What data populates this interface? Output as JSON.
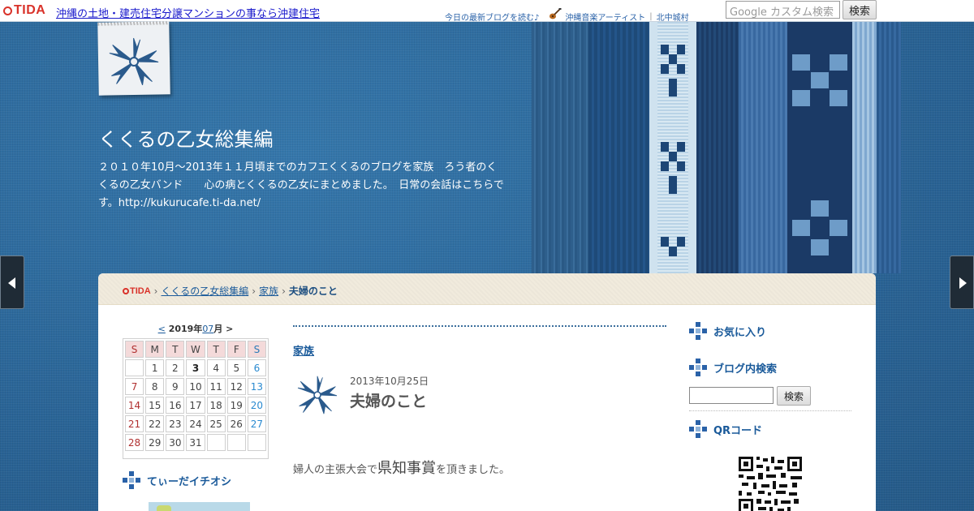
{
  "topbar": {
    "logo": "TIDA",
    "main_link": "沖縄の土地・建売住宅分譲マンションの事なら沖建住宅",
    "links": [
      "今日の最新ブログを読む♪",
      "沖縄音楽アーティスト",
      "北中城村"
    ],
    "search_placeholder": "Google カスタム検索",
    "search_button": "検索"
  },
  "header": {
    "title": "くくるの乙女総集編",
    "description": "２０１０年10月～2013年１１月頃までのカフエくくるのブログを家族　ろう者のくくるの乙女バンド　　心の病とくくるの乙女にまとめました。　日常の会話はこちらです。http://kukurucafe.ti-da.net/"
  },
  "breadcrumb": {
    "logo": "TIDA",
    "items": [
      "くくるの乙女総集編",
      "家族"
    ],
    "current": "夫婦のこと",
    "separator": "›"
  },
  "calendar": {
    "prev": "<",
    "year_label": "2019年",
    "month": "07",
    "month_suffix": "月",
    "next": ">",
    "weekdays": [
      "S",
      "M",
      "T",
      "W",
      "T",
      "F",
      "S"
    ],
    "weeks": [
      [
        "",
        "1",
        "2",
        "3",
        "4",
        "5",
        "6"
      ],
      [
        "7",
        "8",
        "9",
        "10",
        "11",
        "12",
        "13"
      ],
      [
        "14",
        "15",
        "16",
        "17",
        "18",
        "19",
        "20"
      ],
      [
        "21",
        "22",
        "23",
        "24",
        "25",
        "26",
        "27"
      ],
      [
        "28",
        "29",
        "30",
        "31",
        "",
        "",
        ""
      ]
    ],
    "today": "3"
  },
  "sidebar_left": {
    "recommend_heading": "てぃーだイチオシ"
  },
  "entry": {
    "category": "家族",
    "date": "2013年10月25日",
    "title": "夫婦のこと",
    "body_prefix": "婦人の主張大会で",
    "body_emph": "県知事賞",
    "body_suffix": "を頂きました。"
  },
  "sidebar_right": {
    "favorites_heading": "お気に入り",
    "search_heading": "ブログ内検索",
    "search_button": "検索",
    "qr_heading": "QRコード"
  },
  "colors": {
    "background": "#2c6a9c",
    "link": "#1a5a9a",
    "tida_red": "#d9322a",
    "crumb_bg": "#f1ebdd"
  },
  "icons": {
    "tag_logo": "flower-icon",
    "guitar": "guitar-icon",
    "section": "blue-pattern-icon"
  }
}
